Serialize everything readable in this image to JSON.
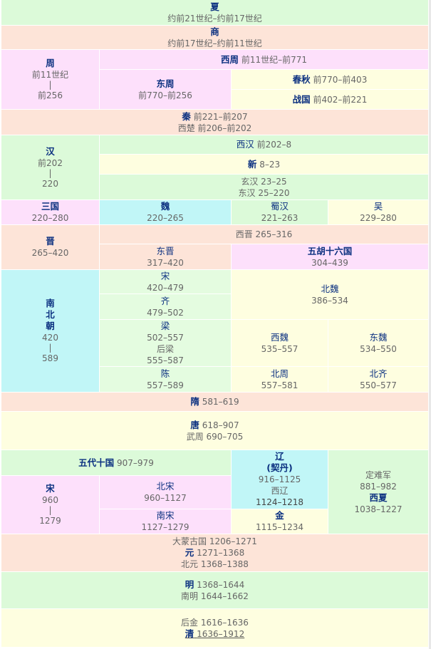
{
  "xia": {
    "name": "夏",
    "dates": "约前21世纪–约前17世纪"
  },
  "shang": {
    "name": "商",
    "dates": "约前17世纪–约前11世纪"
  },
  "zhou": {
    "name": "周",
    "start": "前11世纪",
    "end": "前256",
    "western": {
      "name": "西周",
      "dates": "前11世纪–前771"
    },
    "eastern": {
      "name": "东周",
      "dates": "前770–前256"
    },
    "spring_autumn": {
      "name": "春秋",
      "dates": "前770–前403"
    },
    "warring": {
      "name": "战国",
      "dates": "前402–前221"
    }
  },
  "qin": {
    "name": "秦",
    "dates": "前221–前207",
    "sub": "西楚 前206–前202"
  },
  "han": {
    "name": "汉",
    "start": "前202",
    "end": "220",
    "western": {
      "name": "西汉",
      "dates": "前202–8"
    },
    "xin": {
      "name": "新",
      "dates": "8–23"
    },
    "xuan": "玄汉 23–25",
    "eastern": "东汉 25–220"
  },
  "three_kingdoms": {
    "name": "三国",
    "dates": "220–280",
    "wei": {
      "name": "魏",
      "dates": "220–265"
    },
    "shu": {
      "name": "蜀汉",
      "dates": "221–263"
    },
    "wu": {
      "name": "吴",
      "dates": "229–280"
    }
  },
  "jin": {
    "name": "晋",
    "dates": "265–420",
    "western": "西晋 265–316",
    "eastern": {
      "name": "东晋",
      "dates": "317–420"
    },
    "sixteen": {
      "name": "五胡十六国",
      "dates": "304–439"
    }
  },
  "nanbei": {
    "name": [
      "南",
      "北",
      "朝"
    ],
    "start": "420",
    "end": "589",
    "song": {
      "name": "宋",
      "dates": "420–479"
    },
    "qi": {
      "name": "齐",
      "dates": "479–502"
    },
    "liang": {
      "name": "梁",
      "dates": "502–557",
      "sub": "后梁",
      "sub_dates": "555–587"
    },
    "chen": {
      "name": "陈",
      "dates": "557–589"
    },
    "beiwei": {
      "name": "北魏",
      "dates": "386–534"
    },
    "xiwei": {
      "name": "西魏",
      "dates": "535–557"
    },
    "dongwei": {
      "name": "东魏",
      "dates": "534–550"
    },
    "beizhou": {
      "name": "北周",
      "dates": "557–581"
    },
    "beiqi": {
      "name": "北齐",
      "dates": "550–577"
    }
  },
  "sui": {
    "name": "隋",
    "dates": "581–619"
  },
  "tang": {
    "name": "唐",
    "dates": "618–907",
    "sub": "武周 690–705"
  },
  "wudai": {
    "name": "五代十国",
    "dates": "907–979"
  },
  "liao": {
    "name": "辽",
    "name2": "(契丹)",
    "dates": "916–1125",
    "sub": "西辽",
    "sub_dates": "1124–1218"
  },
  "xixia": {
    "pre": "定难军",
    "pre_dates": "881–982",
    "name": "西夏",
    "dates": "1038–1227"
  },
  "song": {
    "name": "宋",
    "start": "960",
    "end": "1279",
    "northern": {
      "name": "北宋",
      "dates": "960–1127"
    },
    "southern": {
      "name": "南宋",
      "dates": "1127–1279"
    }
  },
  "jin_dyn": {
    "name": "金",
    "dates": "1115–1234"
  },
  "yuan": {
    "pre": "大蒙古国 1206–1271",
    "name": "元",
    "dates": "1271–1368",
    "post": "北元 1368–1388"
  },
  "ming": {
    "name": "明",
    "dates": "1368–1644",
    "sub": "南明 1644–1662"
  },
  "qing": {
    "pre": "后金 1616–1636",
    "name": "清",
    "dates": "1636–1912"
  },
  "bar": "|",
  "colors": {
    "green": "#dcfad9",
    "yellow": "#fefee0",
    "pink": "#fde0fb",
    "orange": "#fde4d8",
    "cyan": "#c1f6f7",
    "name": "#0b3080"
  }
}
